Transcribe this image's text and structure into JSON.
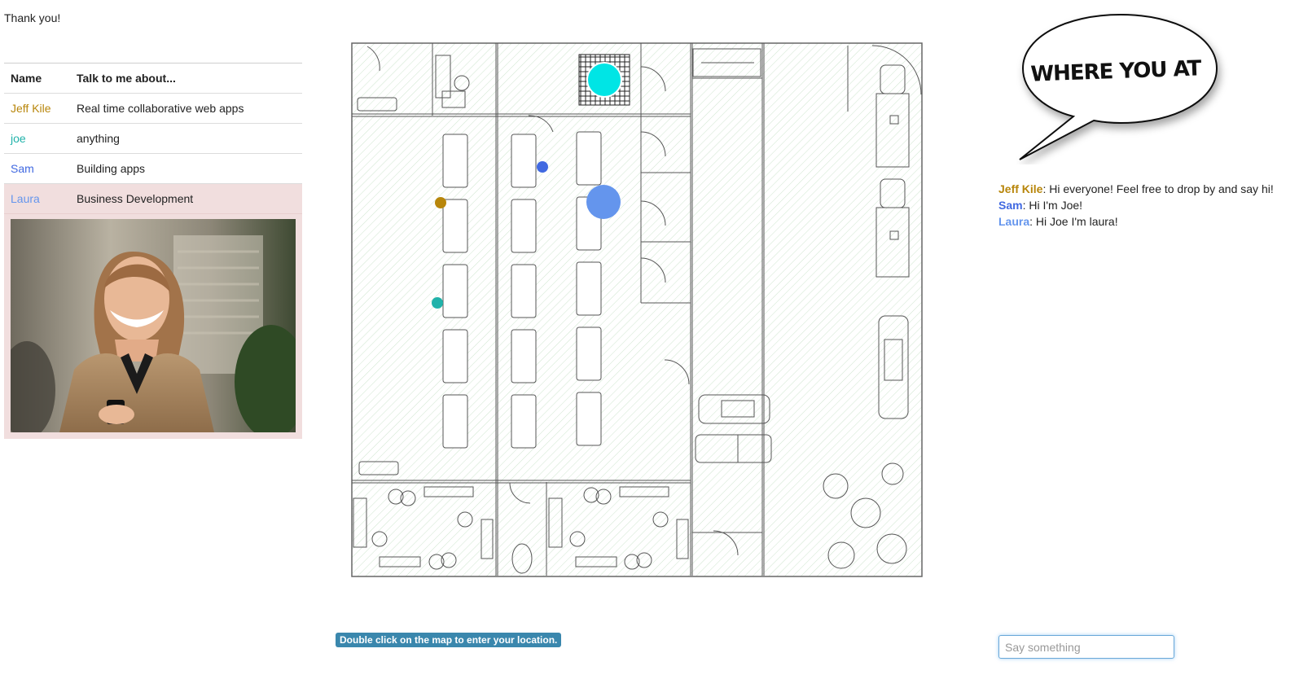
{
  "header": {
    "thank_you": "Thank you!"
  },
  "people_table": {
    "headers": {
      "name": "Name",
      "topic": "Talk to me about..."
    },
    "rows": [
      {
        "name": "Jeff Kile",
        "topic": "Real time collaborative web apps",
        "color": "#b8860b"
      },
      {
        "name": "joe",
        "topic": "anything",
        "color": "#20b2aa"
      },
      {
        "name": "Sam",
        "topic": "Building apps",
        "color": "#4169e1"
      },
      {
        "name": "Laura",
        "topic": "Business Development",
        "color": "#6495ed",
        "selected": true
      }
    ]
  },
  "map": {
    "hint": "Double click on the map to enter your location."
  },
  "bubble": {
    "text": "WHERE YOU AT"
  },
  "chat": {
    "messages": [
      {
        "user": "Jeff Kile",
        "text": ": Hi everyone! Feel free to drop by and say hi!",
        "color": "#b8860b"
      },
      {
        "user": "Sam",
        "text": ": Hi I'm Joe!",
        "color": "#4169e1"
      },
      {
        "user": "Laura",
        "text": ": Hi Joe I'm laura!",
        "color": "#6495ed"
      }
    ],
    "input_placeholder": "Say something"
  },
  "colors": {
    "selected_row": "#f1dede",
    "hint_bg": "#3a87ad",
    "marker_cyan": "#00e5e5",
    "marker_blue": "#4169e1",
    "marker_gold": "#b8860b",
    "marker_teal": "#20b2aa",
    "marker_cornflower": "#6495ed"
  }
}
